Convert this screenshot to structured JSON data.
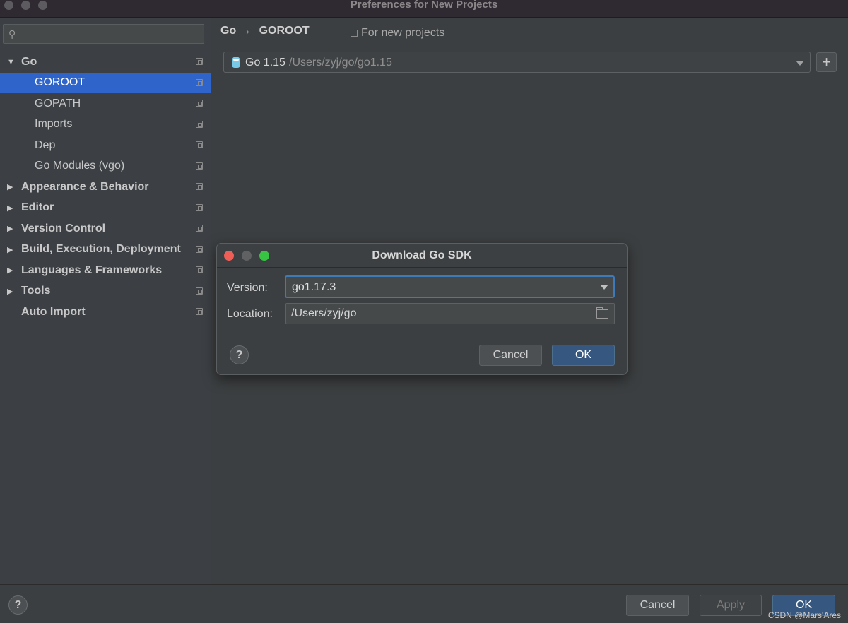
{
  "window": {
    "title": "Preferences for New Projects"
  },
  "sidebar": {
    "items": [
      {
        "label": "Go",
        "level": 0,
        "expanded": true,
        "selected": false
      },
      {
        "label": "GOROOT",
        "level": 1,
        "selected": true
      },
      {
        "label": "GOPATH",
        "level": 1,
        "selected": false
      },
      {
        "label": "Imports",
        "level": 1,
        "selected": false
      },
      {
        "label": "Dep",
        "level": 1,
        "selected": false
      },
      {
        "label": "Go Modules (vgo)",
        "level": 1,
        "selected": false
      },
      {
        "label": "Appearance & Behavior",
        "level": 0,
        "expanded": false,
        "selected": false
      },
      {
        "label": "Editor",
        "level": 0,
        "expanded": false,
        "selected": false
      },
      {
        "label": "Version Control",
        "level": 0,
        "expanded": false,
        "selected": false
      },
      {
        "label": "Build, Execution, Deployment",
        "level": 0,
        "expanded": false,
        "selected": false
      },
      {
        "label": "Languages & Frameworks",
        "level": 0,
        "expanded": false,
        "selected": false
      },
      {
        "label": "Tools",
        "level": 0,
        "expanded": false,
        "selected": false
      },
      {
        "label": "Auto Import",
        "level": 0,
        "leaf": true,
        "selected": false
      }
    ]
  },
  "main": {
    "breadcrumb": {
      "parent": "Go",
      "separator": "›",
      "current": "GOROOT"
    },
    "scope": "For new projects",
    "sdk": {
      "name": "Go 1.15",
      "path": "/Users/zyj/go/go1.15"
    },
    "add_label": "+"
  },
  "dialog": {
    "title": "Download Go SDK",
    "version_label": "Version:",
    "version_value": "go1.17.3",
    "location_label": "Location:",
    "location_value": "/Users/zyj/go",
    "help_label": "?",
    "cancel_label": "Cancel",
    "ok_label": "OK"
  },
  "footer": {
    "help_label": "?",
    "cancel_label": "Cancel",
    "apply_label": "Apply",
    "ok_label": "OK"
  },
  "watermark": "CSDN @Mars'Ares",
  "colors": {
    "selection": "#2f65ca",
    "primary_button": "#365880",
    "focus_border": "#3f7ab8"
  }
}
